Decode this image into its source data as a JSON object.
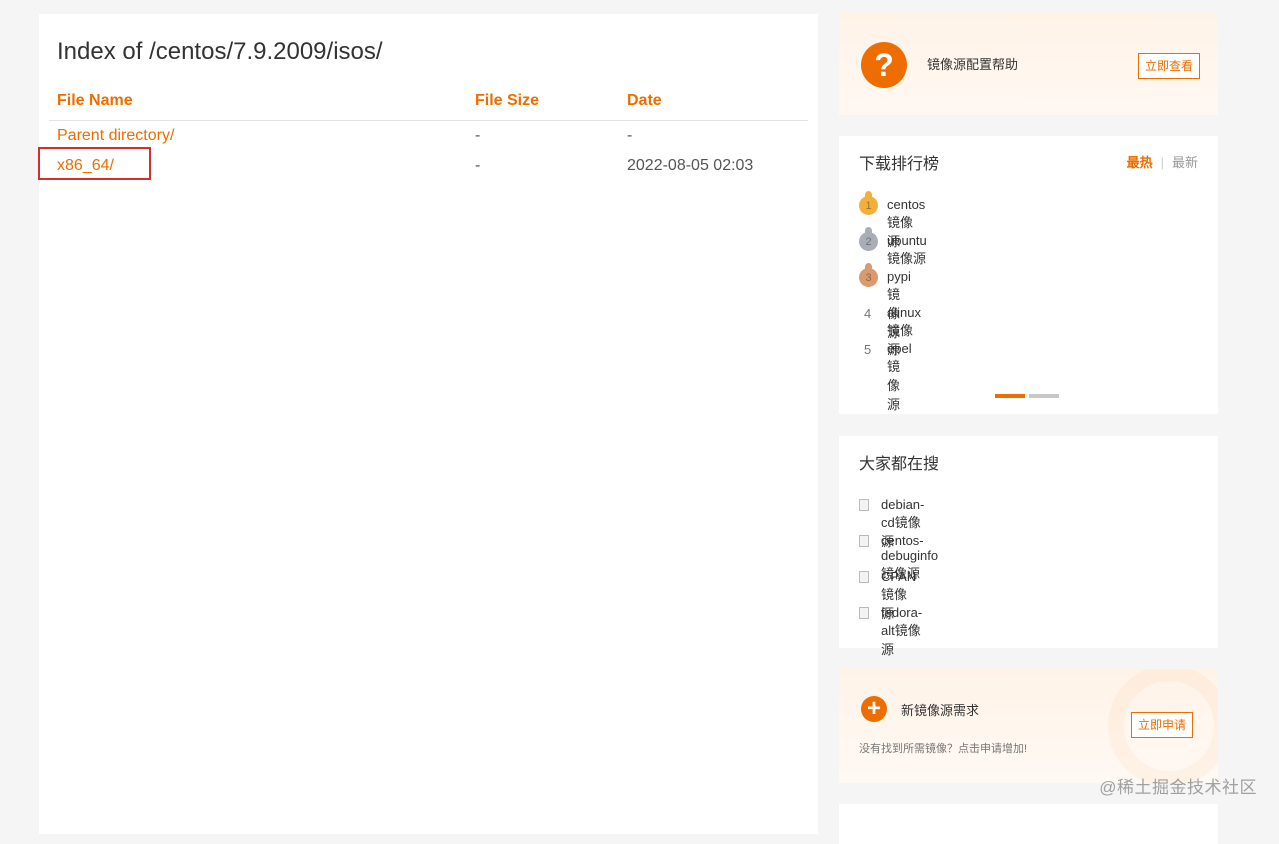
{
  "listing": {
    "title": "Index of /centos/7.9.2009/isos/",
    "headers": {
      "name": "File Name",
      "size": "File Size",
      "date": "Date"
    },
    "rows": [
      {
        "name": "Parent directory/",
        "size": "-",
        "date": "-"
      },
      {
        "name": "x86_64/",
        "size": "-",
        "date": "2022-08-05 02:03"
      }
    ]
  },
  "help": {
    "icon": "question-icon",
    "text": "镜像源配置帮助",
    "button": "立即查看"
  },
  "ranking": {
    "title": "下载排行榜",
    "tabs": {
      "hot": "最热",
      "new": "最新",
      "active": "hot"
    },
    "items": [
      {
        "rank": "1",
        "label": "centos镜像源",
        "medal": "gold"
      },
      {
        "rank": "2",
        "label": "ubuntu镜像源",
        "medal": "silver"
      },
      {
        "rank": "3",
        "label": "pypi镜像源",
        "medal": "bronze"
      },
      {
        "rank": "4",
        "label": "alinux镜像源"
      },
      {
        "rank": "5",
        "label": "epel镜像源"
      }
    ],
    "carousel": {
      "pages": 2,
      "current": 1
    }
  },
  "popular": {
    "title": "大家都在搜",
    "items": [
      "debian-cd镜像源",
      "centos-debuginfo镜像源",
      "CPAN镜像源",
      "fedora-alt镜像源"
    ]
  },
  "request": {
    "icon": "plus-icon",
    "title": "新镜像源需求",
    "subtitle": "没有找到所需镜像？点击申请增加!",
    "button": "立即申请"
  },
  "watermark": "@稀土掘金技术社区",
  "colors": {
    "accent": "#ed6d00",
    "highlight": "#d32f2f"
  }
}
